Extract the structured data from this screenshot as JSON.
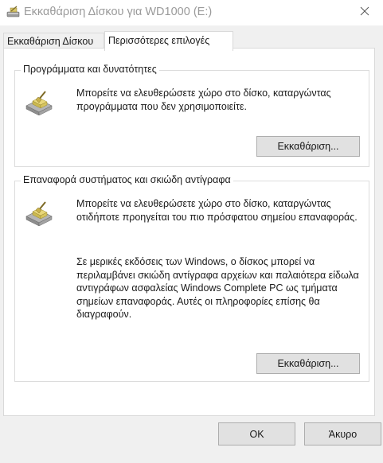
{
  "window": {
    "title": "Εκκαθάριση Δίσκου για WD1000 (E:)",
    "title_icon": "disk-cleanup-icon",
    "close_icon": "close-icon"
  },
  "tabs": [
    {
      "label": "Εκκαθάριση Δίσκου",
      "active": false
    },
    {
      "label": "Περισσότερες επιλογές",
      "active": true
    }
  ],
  "groups": {
    "programs": {
      "legend": "Προγράμματα και δυνατότητες",
      "description": "Μπορείτε να ελευθερώσετε χώρο στο δίσκο, καταργώντας προγράμματα που δεν χρησιμοποιείτε.",
      "button_label": "Εκκαθάριση...",
      "icon": "disk-drive-icon"
    },
    "restore": {
      "legend": "Επαναφορά συστήματος και σκιώδη αντίγραφα",
      "description": "Μπορείτε να ελευθερώσετε χώρο στο δίσκο, καταργώντας οτιδήποτε προηγείται του πιο πρόσφατου σημείου επαναφοράς.",
      "note": "Σε μερικές εκδόσεις των Windows, ο δίσκος μπορεί να περιλαμβάνει σκιώδη αντίγραφα αρχείων και παλαιότερα είδωλα αντιγράφων ασφαλείας Windows Complete PC ως τμήματα σημείων επαναφοράς. Αυτές οι πληροφορίες επίσης θα διαγραφούν.",
      "button_label": "Εκκαθάριση...",
      "icon": "disk-drive-icon"
    }
  },
  "footer": {
    "ok_label": "OK",
    "cancel_label": "Άκυρο"
  }
}
